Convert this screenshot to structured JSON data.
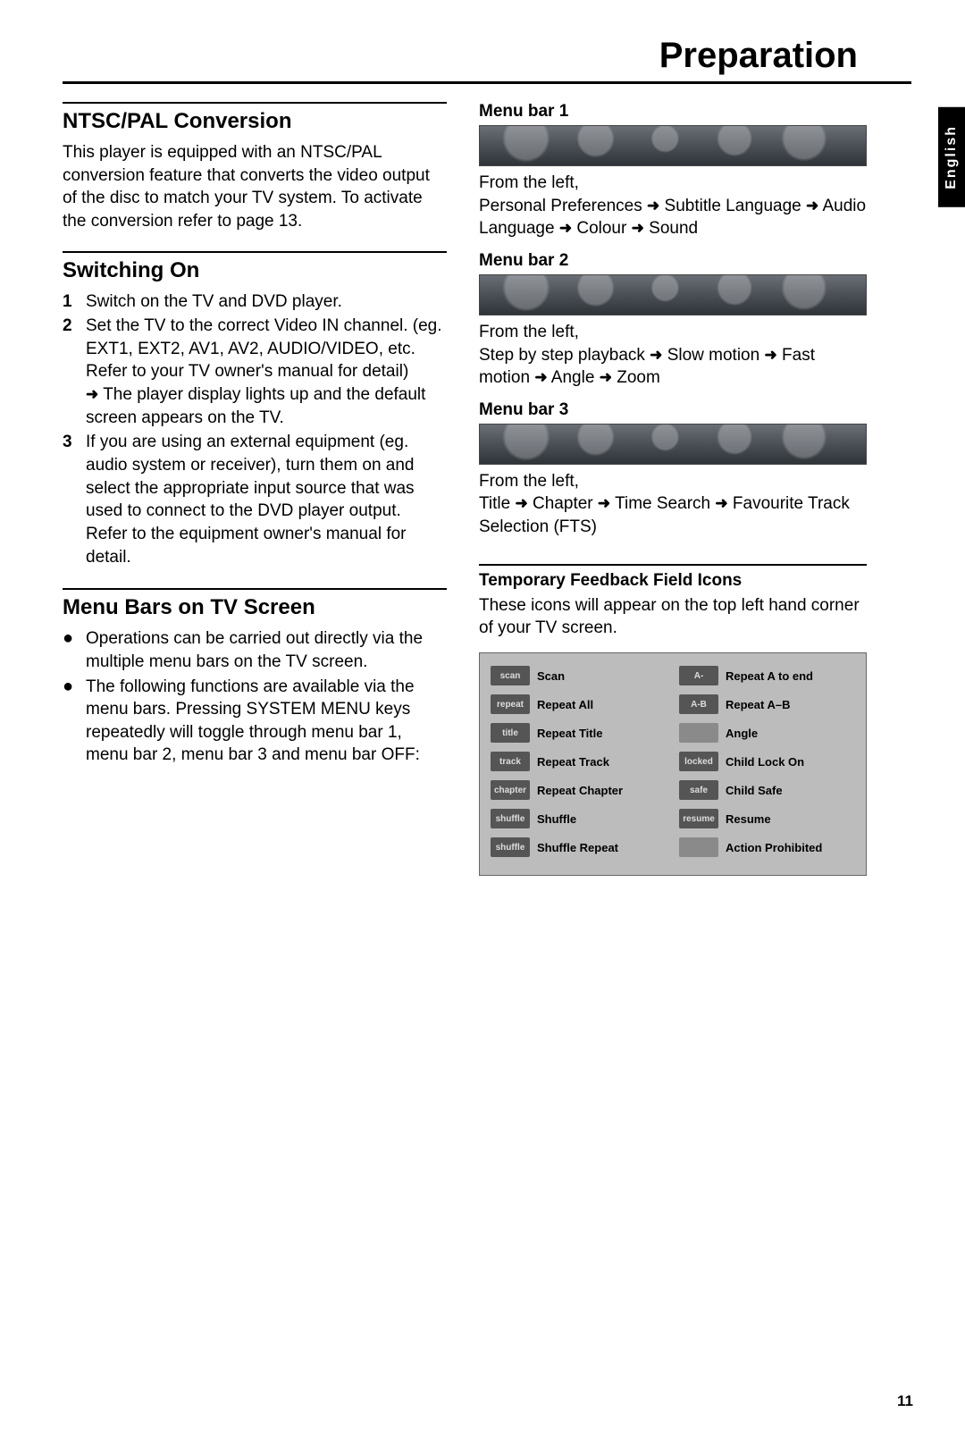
{
  "page": {
    "title": "Preparation",
    "language_tab": "English",
    "page_number": "11"
  },
  "left": {
    "ntsc": {
      "heading": "NTSC/PAL Conversion",
      "body": "This player is equipped with an NTSC/PAL conversion feature that converts the video output of the disc to match your TV system. To activate the conversion refer to page 13."
    },
    "switching_on": {
      "heading": "Switching On",
      "step1_marker": "1",
      "step1": "Switch on the TV and DVD player.",
      "step2_marker": "2",
      "step2_a": "Set the TV to the correct Video IN channel. (eg. EXT1, EXT2, AV1, AV2, AUDIO/VIDEO, etc. Refer to your TV owner's manual for detail)",
      "step2_b": "The player display lights up and the default screen appears on the TV.",
      "step3_marker": "3",
      "step3": "If you are using an external equipment (eg. audio system or receiver), turn them on and select the appropriate input source that was used to connect to the DVD player output. Refer to the equipment owner's manual for detail."
    },
    "menu_bars": {
      "heading": "Menu Bars on TV Screen",
      "bullet_marker": "●",
      "b1": "Operations can be carried out directly via the multiple menu bars on the TV screen.",
      "b2": "The following functions are available via the menu bars. Pressing SYSTEM MENU keys repeatedly will toggle through menu bar 1, menu bar 2, menu bar 3 and menu bar OFF:"
    }
  },
  "right": {
    "arrow_glyph": "➜",
    "mb1": {
      "heading": "Menu bar 1",
      "lead": "From the left,",
      "seq_start": "Personal Preferences",
      "seq_2": "Subtitle Language",
      "seq_3": "Audio Language",
      "seq_4": "Colour",
      "seq_5": "Sound"
    },
    "mb2": {
      "heading": "Menu bar 2",
      "lead": "From the left,",
      "seq_start": "Step by step playback",
      "seq_2": "Slow motion",
      "seq_3": "Fast motion",
      "seq_4": "Angle",
      "seq_5": "Zoom"
    },
    "mb3": {
      "heading": "Menu bar 3",
      "lead": "From the left,",
      "seq_start": "Title",
      "seq_2": "Chapter",
      "seq_3": "Time Search",
      "seq_4": "Favourite Track Selection (FTS)"
    },
    "feedback": {
      "heading": "Temporary Feedback Field Icons",
      "body": "These icons will appear on the top left hand corner of your TV screen.",
      "rows": [
        {
          "l_chip": "scan",
          "l": "Scan",
          "r_chip": "A-",
          "r": "Repeat A to end"
        },
        {
          "l_chip": "repeat",
          "l": "Repeat All",
          "r_chip": "A-B",
          "r": "Repeat A–B"
        },
        {
          "l_chip": "title",
          "l": "Repeat Title",
          "r_chip": "",
          "r": "Angle"
        },
        {
          "l_chip": "track",
          "l": "Repeat Track",
          "r_chip": "locked",
          "r": "Child Lock On"
        },
        {
          "l_chip": "chapter",
          "l": "Repeat Chapter",
          "r_chip": "safe",
          "r": "Child Safe"
        },
        {
          "l_chip": "shuffle",
          "l": "Shuffle",
          "r_chip": "resume",
          "r": "Resume"
        },
        {
          "l_chip": "shuffle",
          "l": "Shuffle Repeat",
          "r_chip": "",
          "r": "Action Prohibited"
        }
      ]
    }
  }
}
